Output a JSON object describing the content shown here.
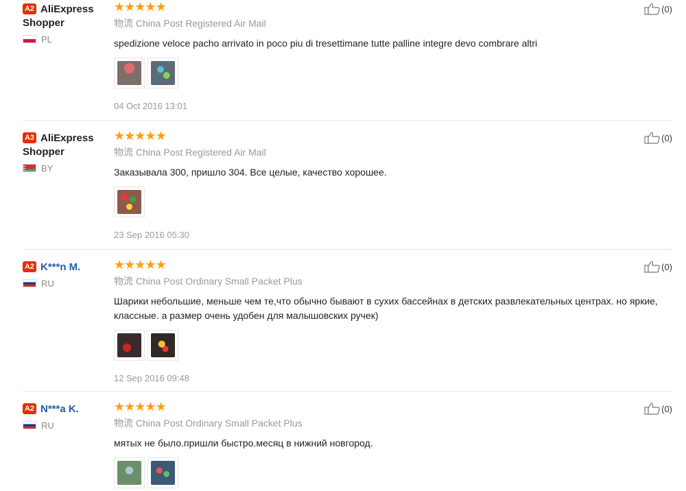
{
  "reviews": [
    {
      "badge": "A2",
      "name_line1": "AliExpress",
      "name_line2": "Shopper",
      "country": "PL",
      "stars": [
        "★",
        "★",
        "★",
        "★",
        "★"
      ],
      "logistics": "物流 China Post Registered Air Mail",
      "text": "spedizione veloce pacho arrivato in poco piu di tresettimane tutte palline integre devo combrare altri",
      "date": "04 Oct 2016 13:01",
      "likes": "(0)"
    },
    {
      "badge": "A3",
      "name_line1": "AliExpress",
      "name_line2": "Shopper",
      "country": "BY",
      "stars": [
        "★",
        "★",
        "★",
        "★",
        "★"
      ],
      "logistics": "物流 China Post Registered Air Mail",
      "text": "Заказывала 300, пришло 304. Все целые, качество хорошее.",
      "date": "23 Sep 2016 05:30",
      "likes": "(0)"
    },
    {
      "badge": "A2",
      "name_line1": "K***n M.",
      "name_line2": "",
      "country": "RU",
      "stars": [
        "★",
        "★",
        "★",
        "★",
        "★"
      ],
      "logistics": "物流 China Post Ordinary Small Packet Plus",
      "text": "Шарики небольшие, меньше чем те,что обычно бывают в сухих бассейнах в детских развлекательных центрах. но яркие, классные. а размер очень удобен для малышовских ручек)",
      "date": "12 Sep 2016 09:48",
      "likes": "(0)"
    },
    {
      "badge": "A2",
      "name_line1": "N***a K.",
      "name_line2": "",
      "country": "RU",
      "stars": [
        "★",
        "★",
        "★",
        "★",
        "★"
      ],
      "logistics": "物流 China Post Ordinary Small Packet Plus",
      "text": "мятых не было.пришли быстро.месяц в нижний новгород.",
      "date": "",
      "likes": "(0)"
    }
  ],
  "colors": {
    "badge": "#e62e04",
    "stars": "#ff9e0e",
    "username_link": "#1e5fa8"
  },
  "icons": {
    "like": "thumbs-up-icon",
    "star": "star-icon",
    "flag_pl": "flag-pl-icon",
    "flag_by": "flag-by-icon",
    "flag_ru": "flag-ru-icon"
  }
}
